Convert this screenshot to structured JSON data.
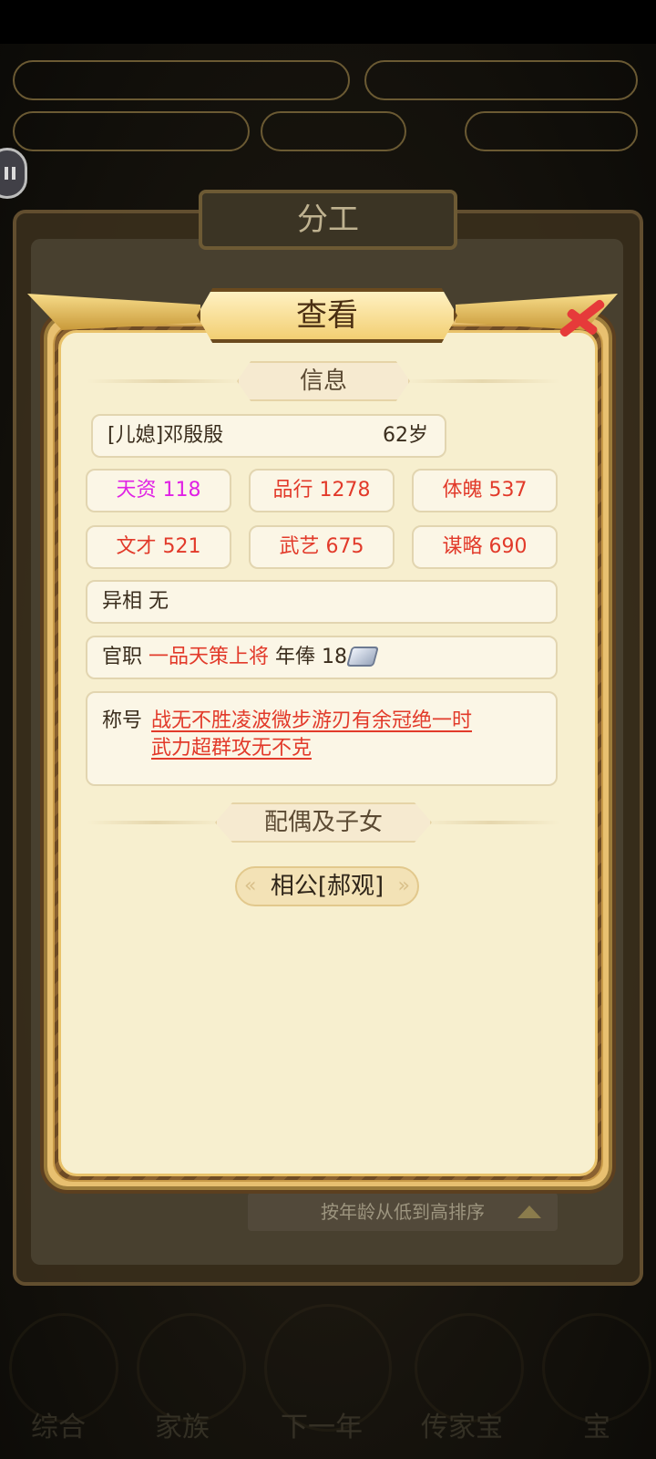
{
  "background": {
    "panel_title": "分工",
    "sort_label": "按年龄从低到高排序",
    "bottom_nav": [
      "综合",
      "家族",
      "下一年",
      "传家宝",
      "宝"
    ]
  },
  "dialog": {
    "title": "查看",
    "info_header": "信息",
    "person": {
      "name": "[儿媳]邓殷殷",
      "age": "62岁"
    },
    "stats": [
      {
        "text": "天资 118",
        "color": "#e021e5"
      },
      {
        "text": "品行 1278",
        "color": "#e23a2a"
      },
      {
        "text": "体魄 537",
        "color": "#e23a2a"
      },
      {
        "text": "文才 521",
        "color": "#e23a2a"
      },
      {
        "text": "武艺 675",
        "color": "#e23a2a"
      },
      {
        "text": "谋略 690",
        "color": "#e23a2a"
      }
    ],
    "trait": {
      "label": "异相",
      "value": "无"
    },
    "office": {
      "label": "官职",
      "value": "一品天策上将",
      "salary_label": "年俸",
      "salary_value": "18",
      "salary_icon": "silver-ingot-icon"
    },
    "titles": {
      "label": "称号",
      "line1": "战无不胜凌波微步游刃有余冠绝一时",
      "line2": "武力超群攻无不克"
    },
    "family_header": "配偶及子女",
    "spouse": "相公[郝观]"
  }
}
